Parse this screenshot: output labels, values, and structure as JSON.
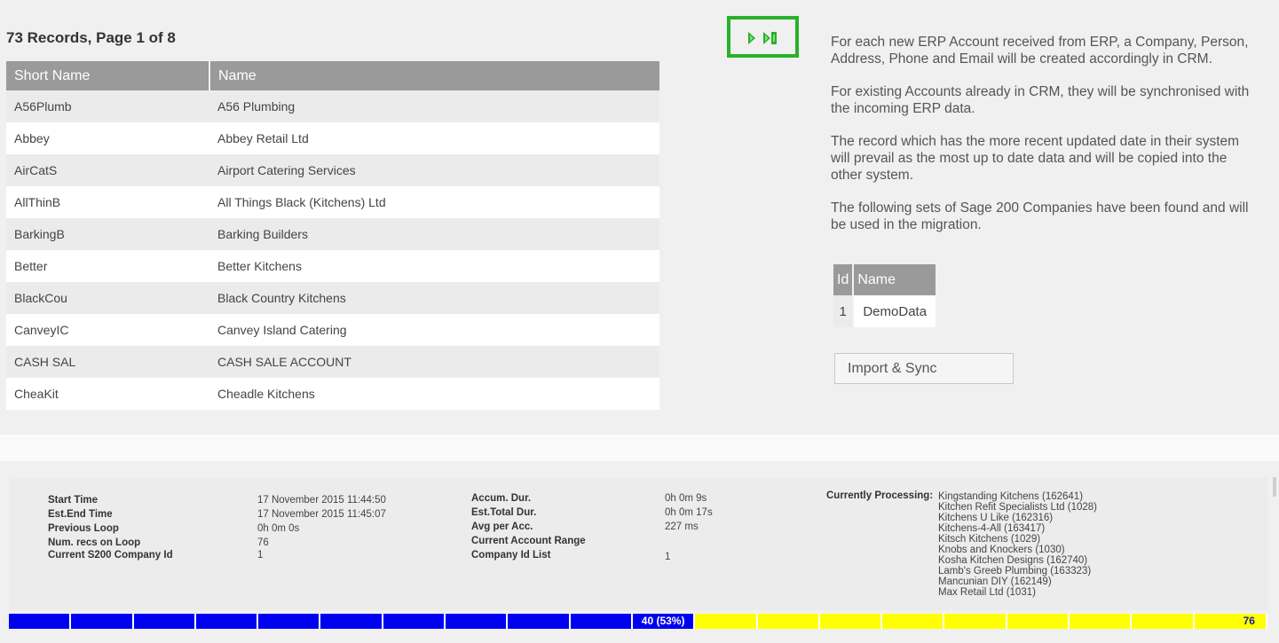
{
  "records": {
    "title": "73 Records, Page 1 of 8",
    "columns": [
      "Short Name",
      "Name"
    ],
    "rows": [
      [
        "A56Plumb",
        "A56 Plumbing"
      ],
      [
        "Abbey",
        "Abbey Retail Ltd"
      ],
      [
        "AirCatS",
        "Airport Catering Services"
      ],
      [
        "AllThinB",
        "All Things Black (Kitchens) Ltd"
      ],
      [
        "BarkingB",
        "Barking Builders"
      ],
      [
        "Better",
        "Better Kitchens"
      ],
      [
        "BlackCou",
        "Black Country Kitchens"
      ],
      [
        "CanveyIC",
        "Canvey Island Catering"
      ],
      [
        "CASH SAL",
        "CASH SALE ACCOUNT"
      ],
      [
        "CheaKit",
        "Cheadle Kitchens"
      ]
    ]
  },
  "nav": {
    "icons": [
      "next-page-icon",
      "last-page-icon"
    ],
    "accent_color": "#28b128"
  },
  "info": {
    "paragraphs": [
      "For each new ERP Account received from ERP, a Company, Person, Address, Phone and Email will be created accordingly in CRM.",
      "For existing Accounts already in CRM, they will be synchronised with the incoming ERP data.",
      "The record which has the more recent updated date in their system will prevail as the most up to date data and will be copied into the other system.",
      "The following sets of Sage 200 Companies have been found and will be used in the migration."
    ]
  },
  "companies": {
    "columns": [
      "Id",
      "Name"
    ],
    "rows": [
      [
        "1",
        "DemoData"
      ]
    ]
  },
  "import_button": "Import & Sync",
  "stats": {
    "left_labels": [
      "Start Time",
      "Est.End Time",
      "Previous Loop",
      "Num. recs on Loop",
      "Current S200 Company Id"
    ],
    "left_values": [
      "17 November 2015 11:44:50",
      "17 November 2015 11:45:07",
      "0h 0m 0s",
      "76",
      "1"
    ],
    "mid_labels": [
      "Accum. Dur.",
      "Est.Total Dur.",
      "Avg per Acc.",
      "Current Account Range",
      "Company Id List"
    ],
    "mid_values": [
      "0h 0m 9s",
      "0h 0m 17s",
      "227 ms",
      "",
      "1"
    ],
    "processing_label": "Currently Processing:",
    "processing": [
      "Kingstanding Kitchens (162641)",
      "Kitchen Refit Specialists Ltd (1028)",
      "Kitchens U Like (162316)",
      "Kitchens-4-All (163417)",
      "Kitsch Kitchens (1029)",
      "Knobs and Knockers (1030)",
      "Kosha Kitchen Designs (162740)",
      "Lamb's Greeb Plumbing (163323)",
      "Mancunian DIY (162149)",
      "Max Retail Ltd (1031)"
    ]
  },
  "progress": {
    "current_label": "40 (53%)",
    "total_label": "76",
    "fraction": 0.53,
    "segments_total": 20,
    "segments_done": 10,
    "done_color": "#0000f0",
    "remaining_color": "#ffff00"
  }
}
